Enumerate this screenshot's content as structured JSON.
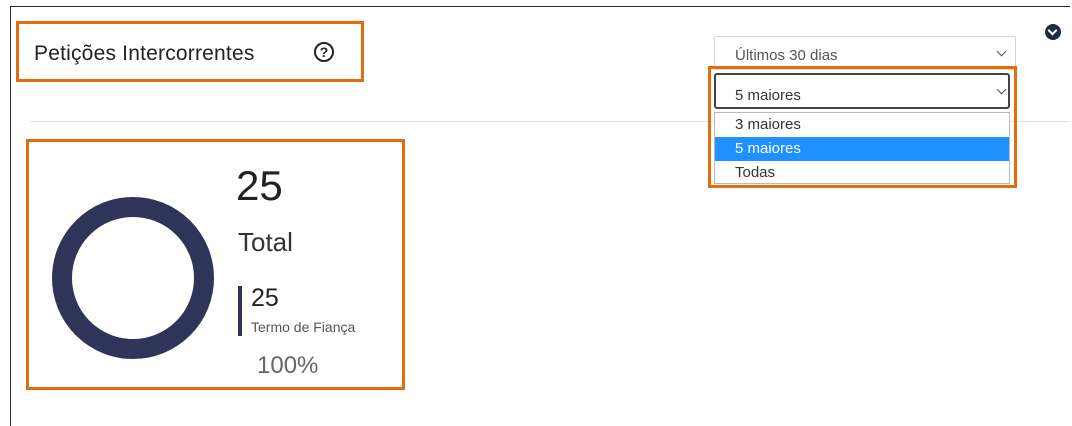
{
  "widget": {
    "title": "Petições Intercorrentes",
    "help_symbol": "?"
  },
  "filters": {
    "period": {
      "selected": "Últimos 30 dias"
    },
    "count": {
      "selected": "5 maiores",
      "options": [
        "3 maiores",
        "5 maiores",
        "Todas"
      ]
    }
  },
  "summary": {
    "total_value": "25",
    "total_label": "Total"
  },
  "legend": {
    "value": "25",
    "label": "Termo de Fiança",
    "percent": "100%"
  },
  "chart_data": {
    "type": "pie",
    "categories": [
      "Termo de Fiança"
    ],
    "values": [
      25
    ],
    "colors": [
      "#2f3559"
    ]
  },
  "icons": {
    "help": "help-icon",
    "collapse": "chevron-down-circle-icon",
    "dropdown": "chevron-down-icon"
  },
  "colors": {
    "highlight": "#e46c0a",
    "option_selected": "#1e90ff",
    "donut": "#2f3559"
  }
}
